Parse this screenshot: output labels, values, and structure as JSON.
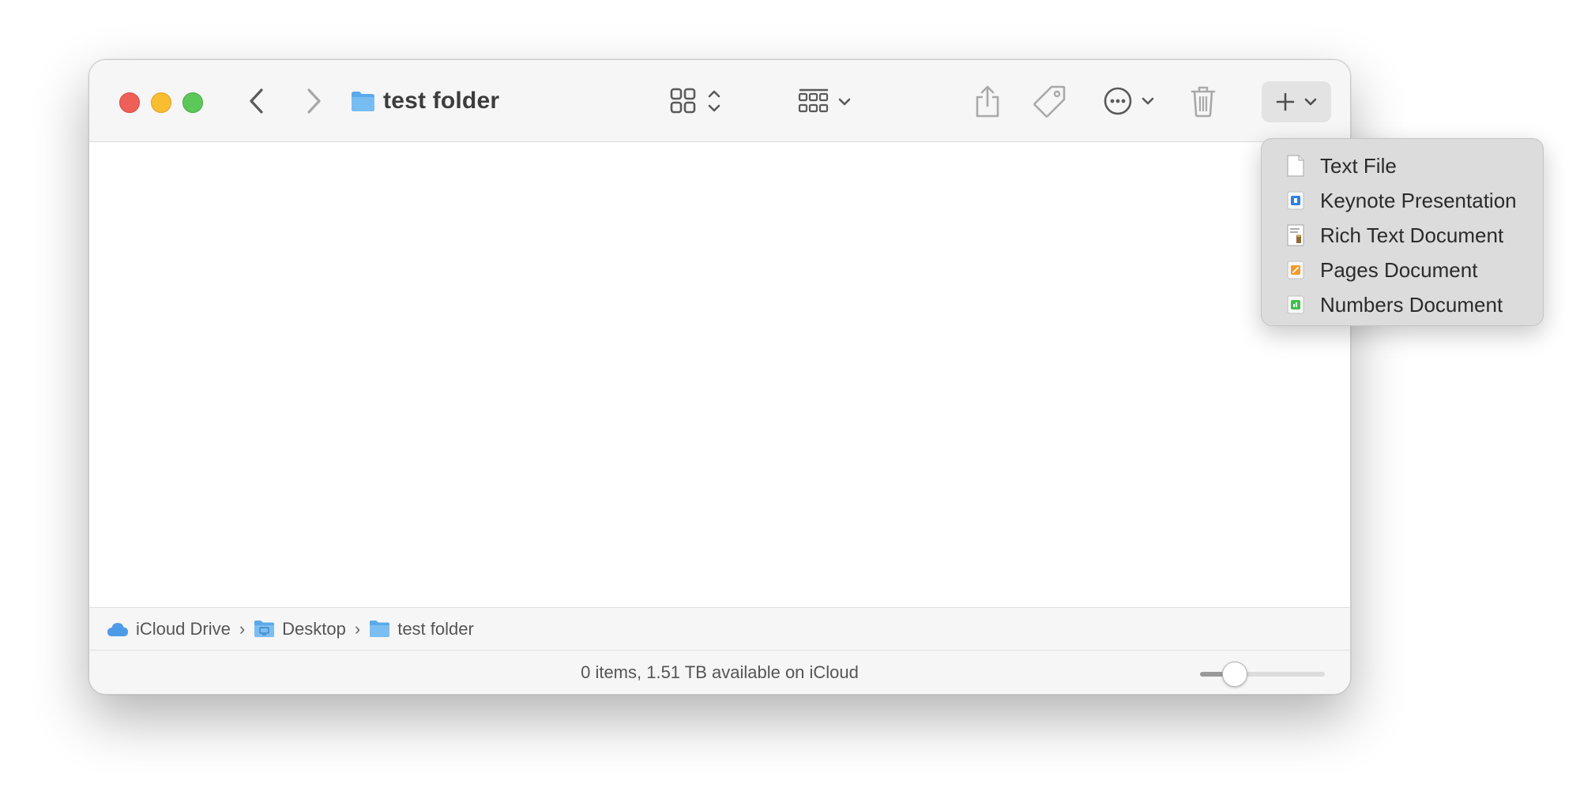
{
  "window": {
    "title": "test folder"
  },
  "toolbar": {
    "back": "chevron-left-icon",
    "forward": "chevron-right-icon",
    "view_mode": "icon-view-grid-icon",
    "group": "group-by-icon",
    "share": "share-icon",
    "tags": "tag-icon",
    "more": "ellipsis-circle-icon",
    "delete": "trash-icon",
    "search": "search-icon",
    "new": "plus-icon"
  },
  "menu": {
    "items": [
      {
        "label": "Text File",
        "icon": "text-file-icon"
      },
      {
        "label": "Keynote Presentation",
        "icon": "keynote-icon"
      },
      {
        "label": "Rich Text Document",
        "icon": "rich-text-icon"
      },
      {
        "label": "Pages Document",
        "icon": "pages-icon"
      },
      {
        "label": "Numbers Document",
        "icon": "numbers-icon"
      }
    ]
  },
  "pathbar": {
    "crumbs": [
      {
        "label": "iCloud Drive",
        "icon": "icloud-icon"
      },
      {
        "label": "Desktop",
        "icon": "desktop-folder-icon"
      },
      {
        "label": "test folder",
        "icon": "folder-icon"
      }
    ]
  },
  "status": {
    "text": "0 items, 1.51 TB available on iCloud",
    "icon_size_level": 0.22
  },
  "colors": {
    "close": "#ee5f58",
    "minimize": "#f8bd30",
    "zoom": "#5cc85a",
    "folder": "#5aa9ea"
  }
}
